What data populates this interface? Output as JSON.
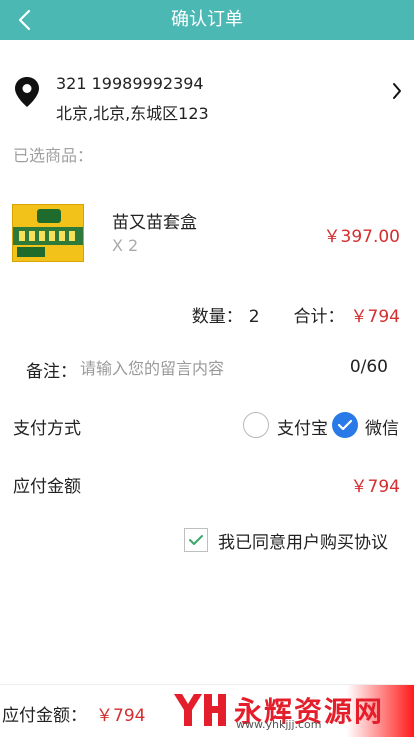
{
  "header": {
    "title": "确认订单"
  },
  "address": {
    "contact": "321 19989992394",
    "detail": "北京,北京,东城区123"
  },
  "selected_label": "已选商品：",
  "product": {
    "name": "苗又苗套盒",
    "quantity": "X 2",
    "price": "￥397.00"
  },
  "summary": {
    "qty_label": "数量：",
    "qty_value": "2",
    "total_label": "合计：",
    "total_value": "￥794"
  },
  "note": {
    "label": "备注：",
    "placeholder": "请输入您的留言内容",
    "value": "",
    "counter": "0/60"
  },
  "payment": {
    "label": "支付方式",
    "options": [
      "支付宝",
      "微信"
    ],
    "selected": "微信"
  },
  "amount_due": {
    "label": "应付金额",
    "value": "￥794"
  },
  "agreement": {
    "text": "我已同意用户购买协议",
    "checked": true
  },
  "bottom_bar": {
    "label": "应付金额：",
    "value": "￥794"
  },
  "watermark": {
    "text": "永辉资源网",
    "url": "www.yhkjjj.com"
  },
  "colors": {
    "header": "#4cb8b3",
    "price": "#d32f2f",
    "radio_selected": "#2979e6",
    "check": "#3aa86b"
  }
}
